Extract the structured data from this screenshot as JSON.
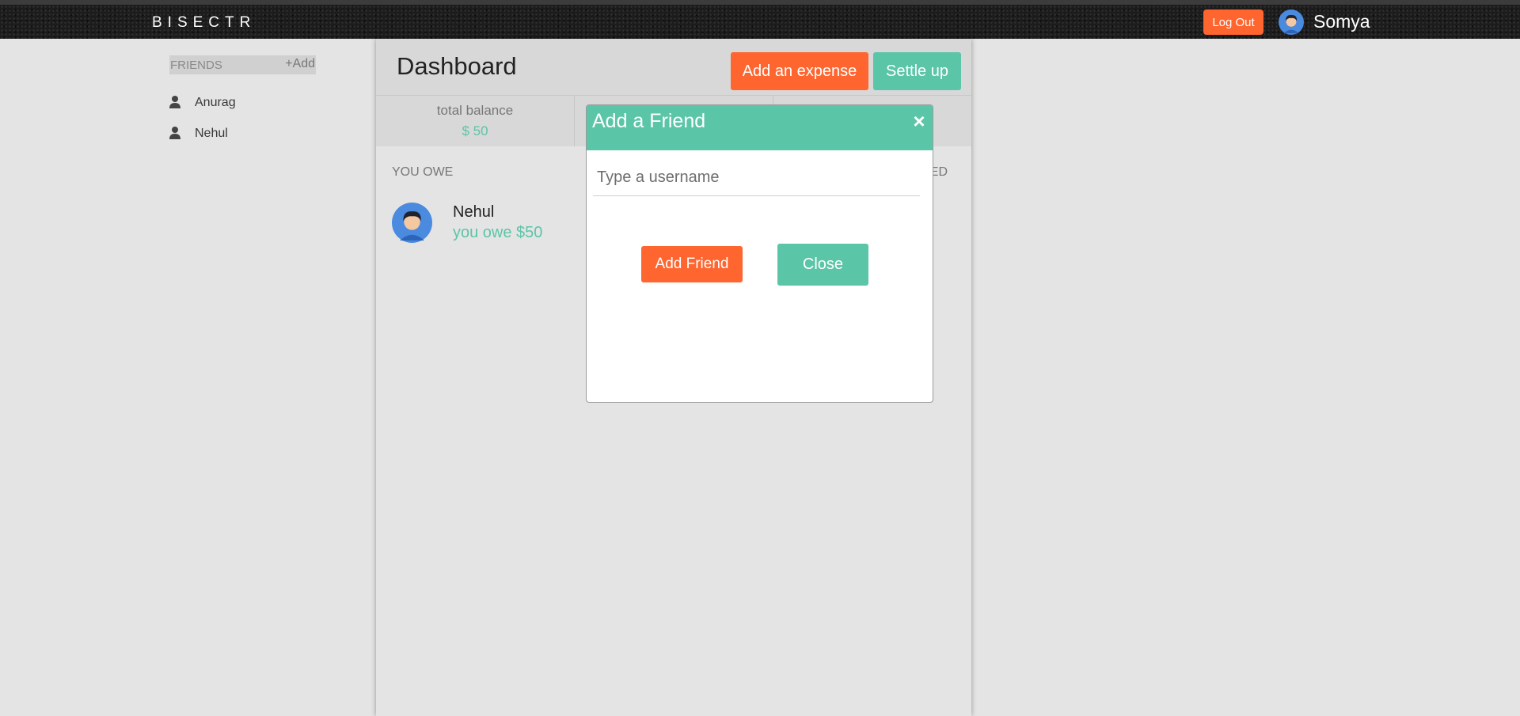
{
  "navbar": {
    "brand": "BISECTR",
    "logout_label": "Log Out",
    "username": "Somya",
    "avatar_icon": "user-avatar-icon"
  },
  "sidebar": {
    "friends_title": "FRIENDS",
    "add_label": "+Add",
    "items": [
      {
        "label": "Anurag",
        "icon": "person-icon"
      },
      {
        "label": "Nehul",
        "icon": "person-icon"
      }
    ]
  },
  "dashboard": {
    "title": "Dashboard",
    "add_expense_label": "Add an expense",
    "settle_up_label": "Settle up",
    "balances": [
      {
        "label": "total balance",
        "value": "$ 50"
      }
    ],
    "you_owe_label": "YOU OWE",
    "owed_label_partial": "ED",
    "you_owe_items": [
      {
        "name": "Nehul",
        "amount_text": "you owe $50"
      }
    ]
  },
  "modal": {
    "title": "Add a Friend",
    "close_icon": "×",
    "input_placeholder": "Type a username",
    "input_value": "",
    "add_button": "Add Friend",
    "close_button": "Close"
  },
  "colors": {
    "accent_orange": "#ff652f",
    "accent_green": "#5bc5a7",
    "background": "#e4e4e4",
    "navbar": "#1c1c1c"
  }
}
